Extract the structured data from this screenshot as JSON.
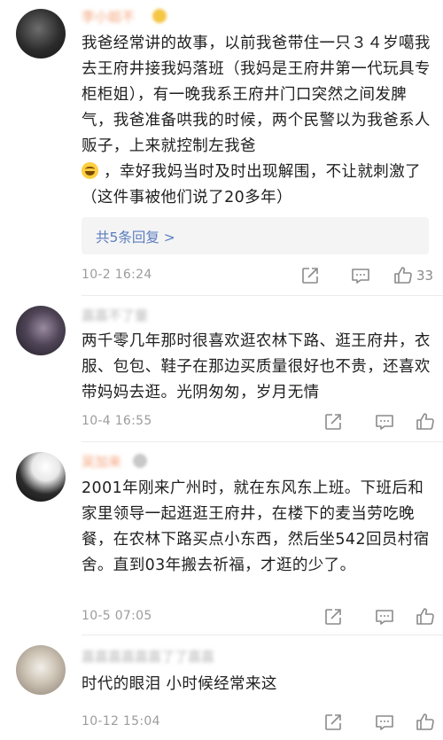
{
  "comments": [
    {
      "username": "李小姐不",
      "text_a": "我爸经常讲的故事，以前我爸带住一只３４岁噶我去王府井接我妈落班（我妈是王府井第一代玩具专柜柜姐），有一晚我系王府井门口突然之间发脾气，我爸准备哄我的时候，两个民警以为我爸系人贩子，上来就控制左我爸",
      "text_b": "，幸好我妈当时及时出现解围，不让就刺激了（这件事被他们说了20多年）",
      "replies_label": "共5条回复 >",
      "time": "10-2 16:24",
      "likes": "33"
    },
    {
      "username": "嘉嘉不了量",
      "text": "两千零几年那时很喜欢逛农林下路、逛王府井，衣服、包包、鞋子在那边买质量很好也不贵，还喜欢带妈妈去逛。光阴匆匆，岁月无情",
      "time": "10-4 16:55",
      "likes": ""
    },
    {
      "username": "吴加来",
      "text": "2001年刚来广州时，就在东风东上班。下班后和家里领导一起逛逛王府井，在楼下的麦当劳吃晚餐，在农林下路买点小东西，然后坐542回员村宿舍。直到03年搬去祈福，才逛的少了。",
      "time": "10-5 07:05",
      "likes": ""
    },
    {
      "username": "嘉嘉嘉嘉嘉嘉了了嘉嘉",
      "text": "时代的眼泪 小时候经常来这",
      "time": "10-12 15:04",
      "likes": ""
    }
  ],
  "icons": {
    "share": "share-icon",
    "comment": "comment-icon",
    "like": "like-icon"
  },
  "colors": {
    "link": "#5a7dbf",
    "muted": "#9c9c9c",
    "body_text": "#1f1f1f"
  }
}
